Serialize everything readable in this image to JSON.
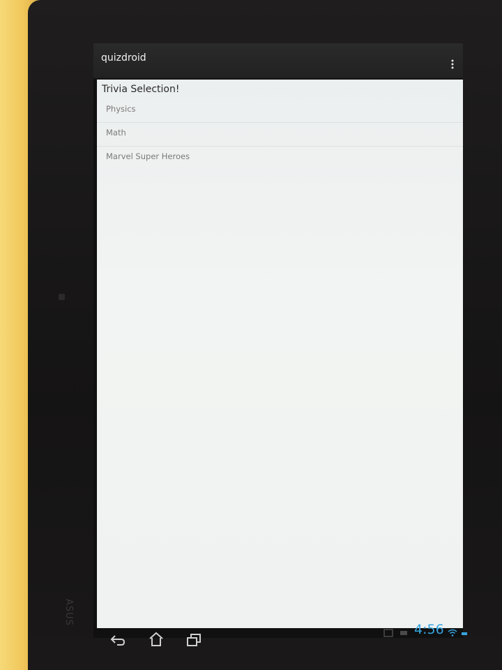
{
  "app": {
    "title": "quizdroid"
  },
  "main": {
    "heading": "Trivia Selection!",
    "topics": [
      {
        "label": "Physics"
      },
      {
        "label": "Math"
      },
      {
        "label": "Marvel Super Heroes"
      }
    ]
  },
  "status_bar": {
    "time": "4:56"
  },
  "device": {
    "brand": "ASUS"
  },
  "icons": {
    "overflow": "overflow-menu-icon",
    "back": "back-icon",
    "home": "home-icon",
    "recent": "recent-apps-icon",
    "wifi": "wifi-icon"
  },
  "colors": {
    "clock": "#36a4e0",
    "action_bar": "#262626",
    "content_bg": "#f0f2f1"
  }
}
